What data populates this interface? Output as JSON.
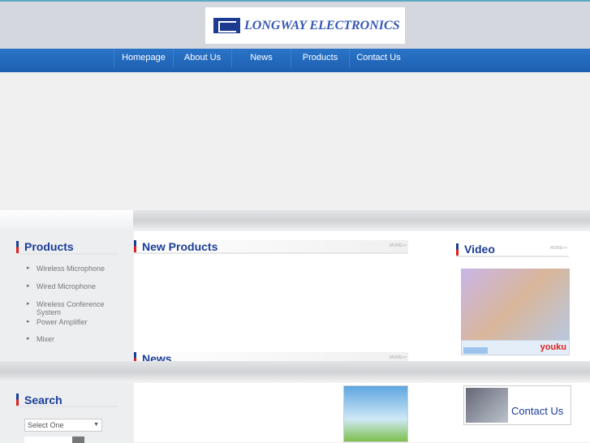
{
  "logo": {
    "text": "LONGWAY ELECTRONICS"
  },
  "nav": [
    "Homepage",
    "About Us",
    "News",
    "Products",
    "Contact Us"
  ],
  "products": {
    "title": "Products",
    "items": [
      "Wireless Microphone",
      "Wired Microphone",
      "Wireless Conference System",
      "Power Amplifier",
      "Mixer"
    ]
  },
  "new_products": {
    "title": "New Products",
    "more": "MORE>>"
  },
  "news": {
    "title": "News",
    "more": "MORE>>"
  },
  "video": {
    "title": "Video",
    "more": "MORE>>",
    "brand": "youku"
  },
  "search": {
    "title": "Search",
    "select": "Select One"
  },
  "contact": {
    "label": "Contact Us"
  }
}
